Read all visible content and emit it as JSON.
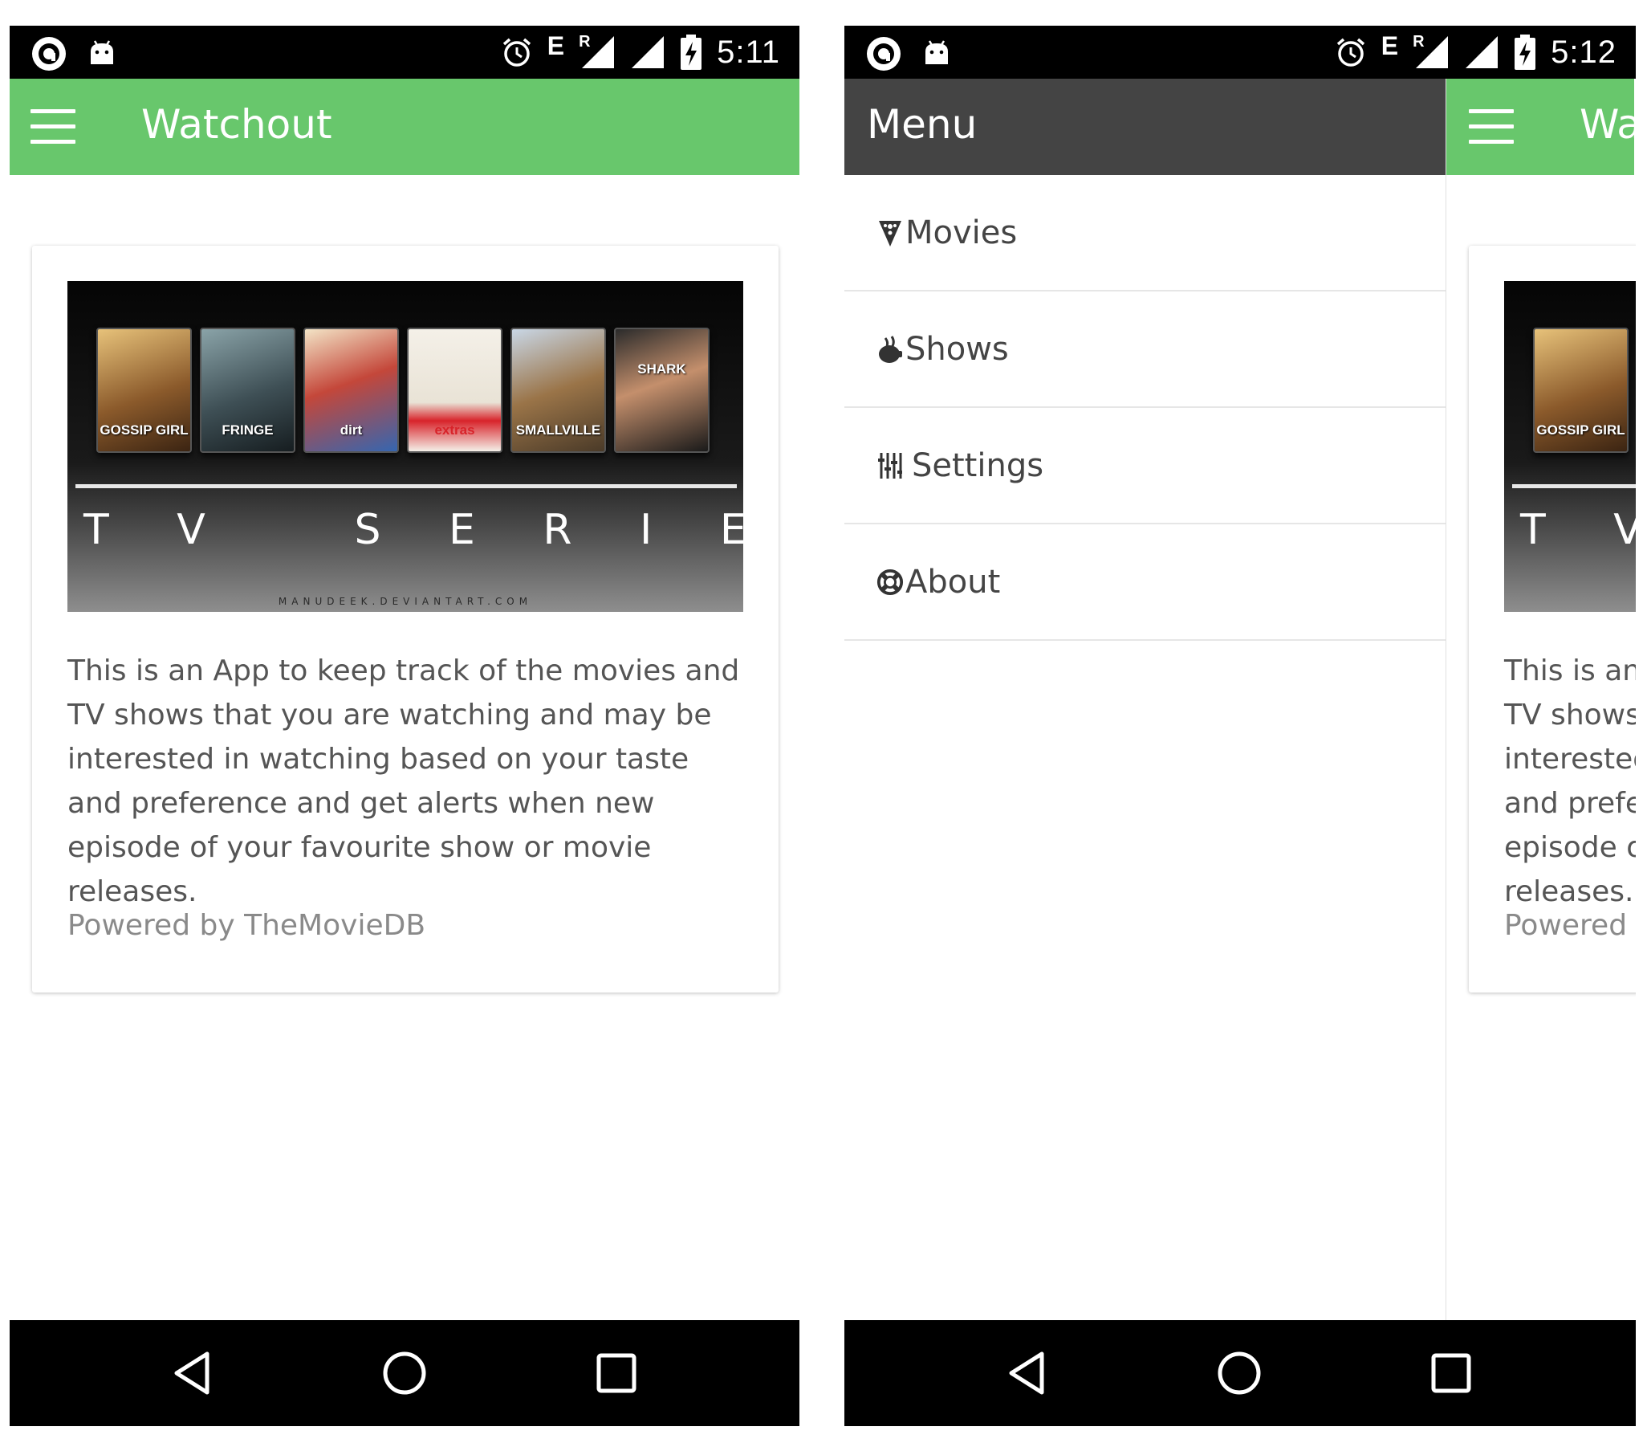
{
  "left": {
    "status_bar": {
      "carrier_indicator": "E",
      "roaming_indicator": "R",
      "time": "5:11"
    },
    "app_bar": {
      "title": "Watchout"
    },
    "banner": {
      "covers": [
        "GOSSIP GIRL",
        "FRINGE",
        "dirt",
        "extras",
        "SMALLVILLE",
        "SHARK"
      ],
      "title": "T V   S E R I E S",
      "credit": "MANUDEEK.DEVIANTART.COM"
    },
    "card": {
      "text": "This is an App to keep track of the movies and TV shows that you are watching and may be interested in watching based on your taste and preference and get alerts when new episode of your favourite show or movie releases.",
      "footer": "Powered by TheMovieDB"
    }
  },
  "right": {
    "status_bar": {
      "carrier_indicator": "E",
      "roaming_indicator": "R",
      "time": "5:12"
    },
    "drawer": {
      "title": "Menu",
      "items": [
        {
          "label": "Movies",
          "icon": "film-icon"
        },
        {
          "label": "Shows",
          "icon": "shows-icon"
        },
        {
          "label": "Settings",
          "icon": "sliders-icon"
        },
        {
          "label": "About",
          "icon": "lifebuoy-icon"
        }
      ]
    },
    "peek": {
      "app_title": "Watchout",
      "banner_title": "T V   S E R I E S",
      "covers": [
        "GOSSIP GIRL"
      ],
      "card_text": "This is an App to keep track of the movies and TV shows that you are watching and may be interested in watching based on your taste and preference and get alerts when new episode of your favourite show or movie releases.",
      "card_footer": "Powered by TheMovieDB"
    }
  },
  "colors": {
    "app_bar": "#68c76c",
    "drawer_header": "#444444",
    "status_bar": "#000000",
    "nav_bar": "#000000"
  }
}
